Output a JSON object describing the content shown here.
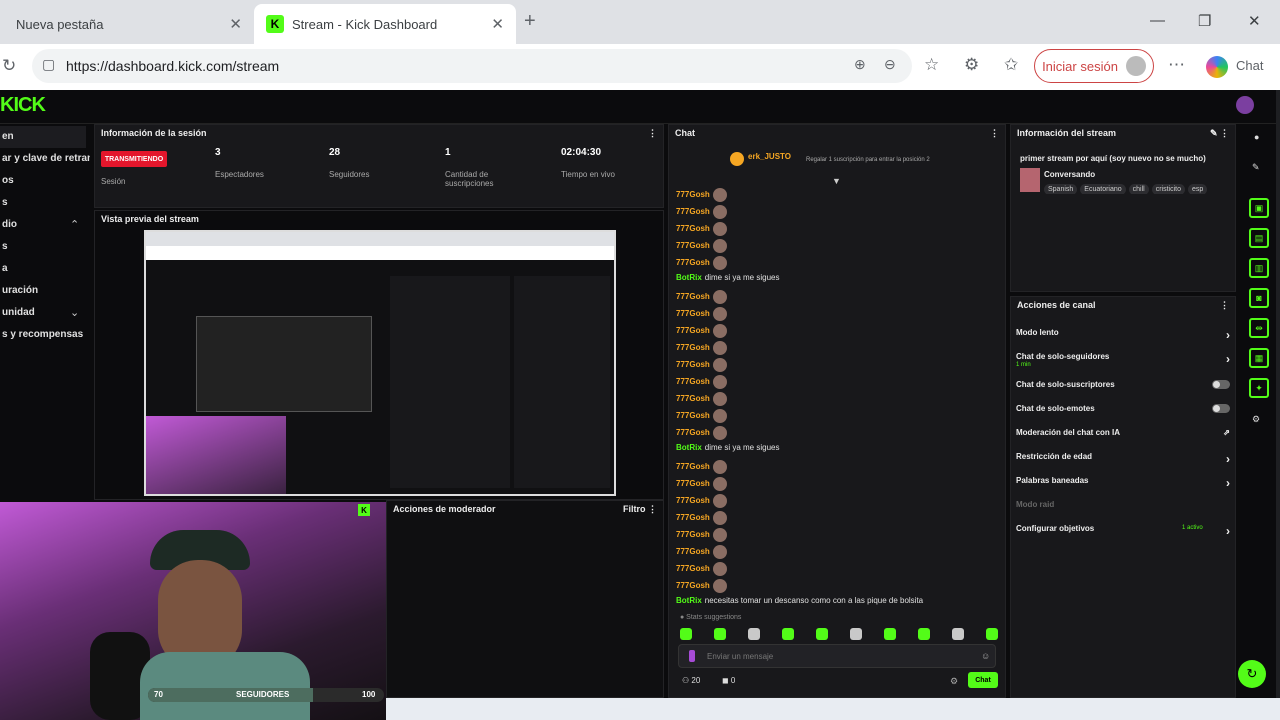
{
  "browser": {
    "tabs": [
      {
        "title": "Nueva pestaña"
      },
      {
        "title": "Stream - Kick Dashboard"
      }
    ],
    "url": "https://dashboard.kick.com/stream",
    "signin_label": "Iniciar sesión",
    "chat_label": "Chat"
  },
  "app": {
    "logo": "KICK",
    "nav_items": [
      "en",
      "ar y clave de retrans",
      "os",
      "s",
      "dio",
      "s",
      "a",
      "uración",
      "unidad",
      "s y recompensas"
    ],
    "session": {
      "title": "Información de la sesión",
      "live_badge": "TRANSMITIENDO",
      "live_label": "Sesión",
      "stats": [
        {
          "value": "3",
          "label": "Espectadores"
        },
        {
          "value": "28",
          "label": "Seguidores"
        },
        {
          "value": "1",
          "label": "Cantidad de suscripciones"
        },
        {
          "value": "02:04:30",
          "label": "Tiempo en vivo"
        }
      ]
    },
    "preview_title": "Vista previa del stream",
    "moderator_title": "Acciones de moderador",
    "filter_label": "Filtro",
    "chat": {
      "title": "Chat",
      "pinned_user": "erk_JUSTO",
      "pinned_text": "Regalar 1 suscripción para entrar la posición 2",
      "lines": [
        {
          "user": "777Gosh",
          "text": ""
        },
        {
          "user": "777Gosh",
          "text": ""
        },
        {
          "user": "777Gosh",
          "text": ""
        },
        {
          "user": "777Gosh",
          "text": ""
        },
        {
          "user": "777Gosh",
          "text": ""
        },
        {
          "user": "BotRix",
          "text": "dime si ya me sigues",
          "bot": true
        },
        {
          "user": "777Gosh",
          "text": ""
        },
        {
          "user": "777Gosh",
          "text": ""
        },
        {
          "user": "777Gosh",
          "text": ""
        },
        {
          "user": "777Gosh",
          "text": ""
        },
        {
          "user": "777Gosh",
          "text": ""
        },
        {
          "user": "777Gosh",
          "text": ""
        },
        {
          "user": "777Gosh",
          "text": ""
        },
        {
          "user": "777Gosh",
          "text": ""
        },
        {
          "user": "777Gosh",
          "text": ""
        },
        {
          "user": "BotRix",
          "text": "dime si ya me sigues",
          "bot": true
        },
        {
          "user": "777Gosh",
          "text": ""
        },
        {
          "user": "777Gosh",
          "text": ""
        },
        {
          "user": "777Gosh",
          "text": ""
        },
        {
          "user": "777Gosh",
          "text": ""
        },
        {
          "user": "777Gosh",
          "text": ""
        },
        {
          "user": "777Gosh",
          "text": ""
        },
        {
          "user": "777Gosh",
          "text": ""
        },
        {
          "user": "777Gosh",
          "text": ""
        },
        {
          "user": "BotRix",
          "text": "necesitas tomar un descanso como con a las pique de bolsita",
          "bot": true
        }
      ],
      "placeholder": "Enviar un mensaje",
      "send_label": "Chat",
      "counts": [
        "20",
        "0"
      ]
    },
    "stream_info": {
      "title": "Información del stream",
      "stream_title": "primer stream por aquí (soy nuevo no se mucho)",
      "category": "Conversando",
      "tags": [
        "Spanish",
        "Ecuatoriano",
        "chill",
        "cristicito",
        "esp"
      ]
    },
    "channel_actions": {
      "title": "Acciones de canal",
      "items": [
        {
          "label": "Modo lento",
          "kind": "arrow"
        },
        {
          "label": "Chat de solo-seguidores",
          "sub": "1 min",
          "kind": "arrow"
        },
        {
          "label": "Chat de solo-suscriptores",
          "kind": "toggle"
        },
        {
          "label": "Chat de solo-emotes",
          "kind": "toggle"
        },
        {
          "label": "Moderación del chat con IA",
          "kind": "link"
        },
        {
          "label": "Restricción de edad",
          "kind": "arrow"
        },
        {
          "label": "Palabras baneadas",
          "kind": "arrow"
        },
        {
          "label": "Modo raid",
          "kind": "none"
        },
        {
          "label": "Configurar objetivos",
          "sub": "1 activo",
          "kind": "arrow"
        }
      ]
    },
    "follower_goal": {
      "label": "SEGUIDORES",
      "current": "70",
      "target": "100",
      "progress": 0.7
    },
    "colors": {
      "accent": "#53fc18",
      "live": "#e4162c",
      "bg": "#0b0b0d",
      "panel": "#18181b"
    }
  }
}
